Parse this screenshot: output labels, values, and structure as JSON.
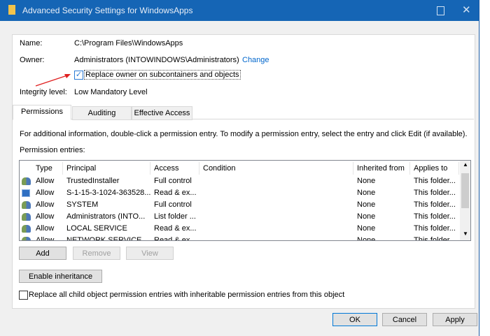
{
  "window": {
    "title": "Advanced Security Settings for WindowsApps"
  },
  "info": {
    "name_label": "Name:",
    "name_value": "C:\\Program Files\\WindowsApps",
    "owner_label": "Owner:",
    "owner_value": "Administrators (INTOWINDOWS\\Administrators)",
    "change_link": "Change",
    "replace_owner_label": "Replace owner on subcontainers and objects",
    "replace_owner_checked": true,
    "integrity_label": "Integrity level:",
    "integrity_value": "Low Mandatory Level"
  },
  "tabs": [
    "Permissions",
    "Auditing",
    "Effective Access"
  ],
  "permissions": {
    "info_text": "For additional information, double-click a permission entry. To modify a permission entry, select the entry and click Edit (if available).",
    "entries_label": "Permission entries:",
    "columns": [
      "Type",
      "Principal",
      "Access",
      "Condition",
      "Inherited from",
      "Applies to"
    ],
    "rows": [
      {
        "icon": "users-icon",
        "type": "Allow",
        "principal": "TrustedInstaller",
        "access": "Full control",
        "condition": "",
        "inherited": "None",
        "applies": "This folder..."
      },
      {
        "icon": "app-package-icon",
        "type": "Allow",
        "principal": "S-1-15-3-1024-363528...",
        "access": "Read & ex...",
        "condition": "",
        "inherited": "None",
        "applies": "This folder..."
      },
      {
        "icon": "users-icon",
        "type": "Allow",
        "principal": "SYSTEM",
        "access": "Full control",
        "condition": "",
        "inherited": "None",
        "applies": "This folder..."
      },
      {
        "icon": "users-icon",
        "type": "Allow",
        "principal": "Administrators (INTO...",
        "access": "List folder ...",
        "condition": "",
        "inherited": "None",
        "applies": "This folder..."
      },
      {
        "icon": "users-icon",
        "type": "Allow",
        "principal": "LOCAL SERVICE",
        "access": "Read & ex...",
        "condition": "",
        "inherited": "None",
        "applies": "This folder..."
      },
      {
        "icon": "users-icon",
        "type": "Allow",
        "principal": "NETWORK SERVICE",
        "access": "Read & ex...",
        "condition": "",
        "inherited": "None",
        "applies": "This folder..."
      }
    ],
    "add": "Add",
    "remove": "Remove",
    "view": "View",
    "enable_inheritance": "Enable inheritance",
    "replace_child_label": "Replace all child object permission entries with inheritable permission entries from this object"
  },
  "footer": {
    "ok": "OK",
    "cancel": "Cancel",
    "apply": "Apply"
  }
}
